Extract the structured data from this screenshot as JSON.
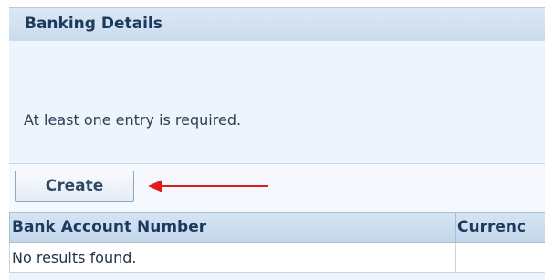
{
  "section": {
    "title": "Banking Details",
    "instruction": "At least one entry is required."
  },
  "toolbar": {
    "create_label": "Create"
  },
  "table": {
    "columns": [
      "Bank Account Number",
      "Currenc"
    ],
    "empty_message": "No results found."
  },
  "colors": {
    "annotation_arrow": "#e01b1b",
    "header_text": "#1c3a5e",
    "panel_background": "#edf4fb"
  },
  "annotations": {
    "arrow_icon": "left-arrow-icon"
  }
}
